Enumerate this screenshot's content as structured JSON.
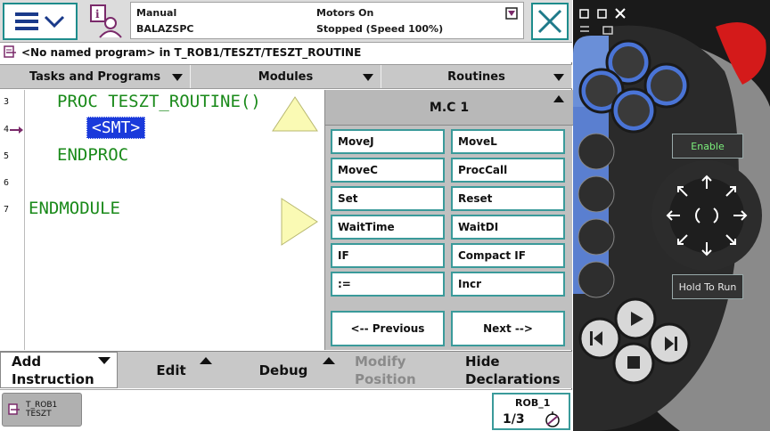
{
  "topbar": {
    "mode": "Manual",
    "controller": "BALAZSPC",
    "motors": "Motors On",
    "state": "Stopped (Speed 100%)"
  },
  "breadcrumb": {
    "text": "<No named program> in T_ROB1/TESZT/TESZT_ROUTINE"
  },
  "tabs": [
    {
      "label": "Tasks and Programs"
    },
    {
      "label": "Modules"
    },
    {
      "label": "Routines"
    }
  ],
  "editor": {
    "lines": [
      {
        "num": "3",
        "code": "PROC TESZT_ROUTINE()"
      },
      {
        "num": "4",
        "code": "<SMT>"
      },
      {
        "num": "5",
        "code": "ENDPROC"
      },
      {
        "num": "6",
        "code": ""
      },
      {
        "num": "7",
        "code": "ENDMODULE"
      }
    ]
  },
  "picker": {
    "title": "M.C 1",
    "buttons": [
      "MoveJ",
      "MoveL",
      "MoveC",
      "ProcCall",
      "Set",
      "Reset",
      "WaitTime",
      "WaitDI",
      "IF",
      "Compact IF",
      ":=",
      "Incr"
    ],
    "previous": "<--  Previous",
    "next": "Next  -->"
  },
  "bottombar": {
    "add_line1": "Add",
    "add_line2": "Instruction",
    "edit": "Edit",
    "debug": "Debug",
    "modify_line1": "Modify",
    "modify_line2": "Position",
    "hide_line1": "Hide",
    "hide_line2": "Declarations"
  },
  "footer": {
    "task_line1": "T_ROB1",
    "task_line2": "TESZT",
    "rob_label": "ROB_1",
    "rob_fraction": "1/3"
  },
  "device": {
    "enable": "Enable",
    "hold": "Hold To Run"
  },
  "colors": {
    "accent": "#1e8c8c",
    "code_green": "#1a8a1a",
    "selection_blue": "#1a3adb",
    "device_blue": "#3a6fd8"
  }
}
